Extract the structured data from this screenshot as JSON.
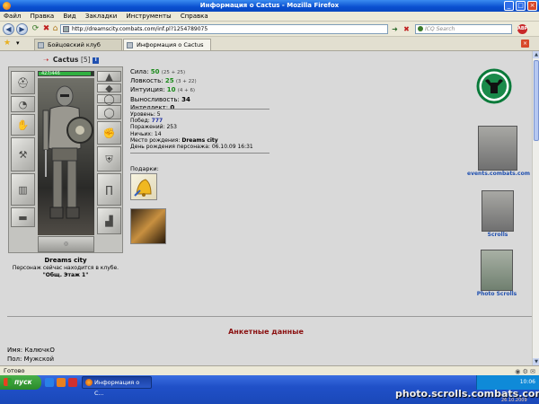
{
  "window": {
    "title": "Информация о Cactus - Mozilla Firefox"
  },
  "menu": [
    "Файл",
    "Правка",
    "Вид",
    "Закладки",
    "Инструменты",
    "Справка"
  ],
  "nav": {
    "url": "http://dreamscity.combats.com/inf.pl?1254789075",
    "search_placeholder": "ICQ Search",
    "adblock_label": "ABP"
  },
  "tabs": [
    {
      "label": "Бойцовский клуб"
    },
    {
      "label": "Информация о Cactus"
    }
  ],
  "character": {
    "name": "Cactus",
    "level": "[5]",
    "clan_tag": "i",
    "hp": "427/446",
    "hp_fraction": 0.957,
    "city": "Dreams city",
    "location_text": "Персонаж сейчас находится в клубе.",
    "location_room": "\"Общ. Этаж 1\""
  },
  "stats": [
    {
      "label": "Сила:",
      "value": "50",
      "bonus": "(25 + 25)"
    },
    {
      "label": "Ловкость:",
      "value": "25",
      "bonus": "(3 + 22)"
    },
    {
      "label": "Интуиция:",
      "value": "10",
      "bonus": "(4 + 6)"
    },
    {
      "label": "Выносливость:",
      "value": "34",
      "bonus": ""
    },
    {
      "label": "Интеллект:",
      "value": "0",
      "bonus": ""
    }
  ],
  "record": {
    "level_label": "Уровень:",
    "level": "5",
    "wins_label": "Побед:",
    "wins": "777",
    "losses_label": "Поражений:",
    "losses": "253",
    "draws_label": "Ничьих:",
    "draws": "14",
    "birthplace_label": "Место рождения:",
    "birthplace": "Dreams city",
    "birthday_label": "День рождения персонажа:",
    "birthday": "06.10.09 16:31"
  },
  "gifts_label": "Подарки:",
  "sidebar": {
    "events_label": "events.combats.com",
    "scrolls_label": "Scrolls",
    "photo_label": "Photo Scrolls"
  },
  "profile": {
    "heading": "Анкетные данные",
    "name_label": "Имя:",
    "name": "КалючкО",
    "sex_label": "Пол:",
    "sex": "Мужской"
  },
  "status": "Готово",
  "taskbar": {
    "start": "пуск",
    "task": "Информация о C...",
    "clock": "10:06"
  },
  "watermark": {
    "text": "photo.scrolls.combats.com",
    "date": "26.10.2009"
  },
  "colors": {
    "stat_value": "#1a8a1a",
    "heading": "#8a1010",
    "link_blue": "#2050b0",
    "xp_blue": "#3a8cf0"
  }
}
